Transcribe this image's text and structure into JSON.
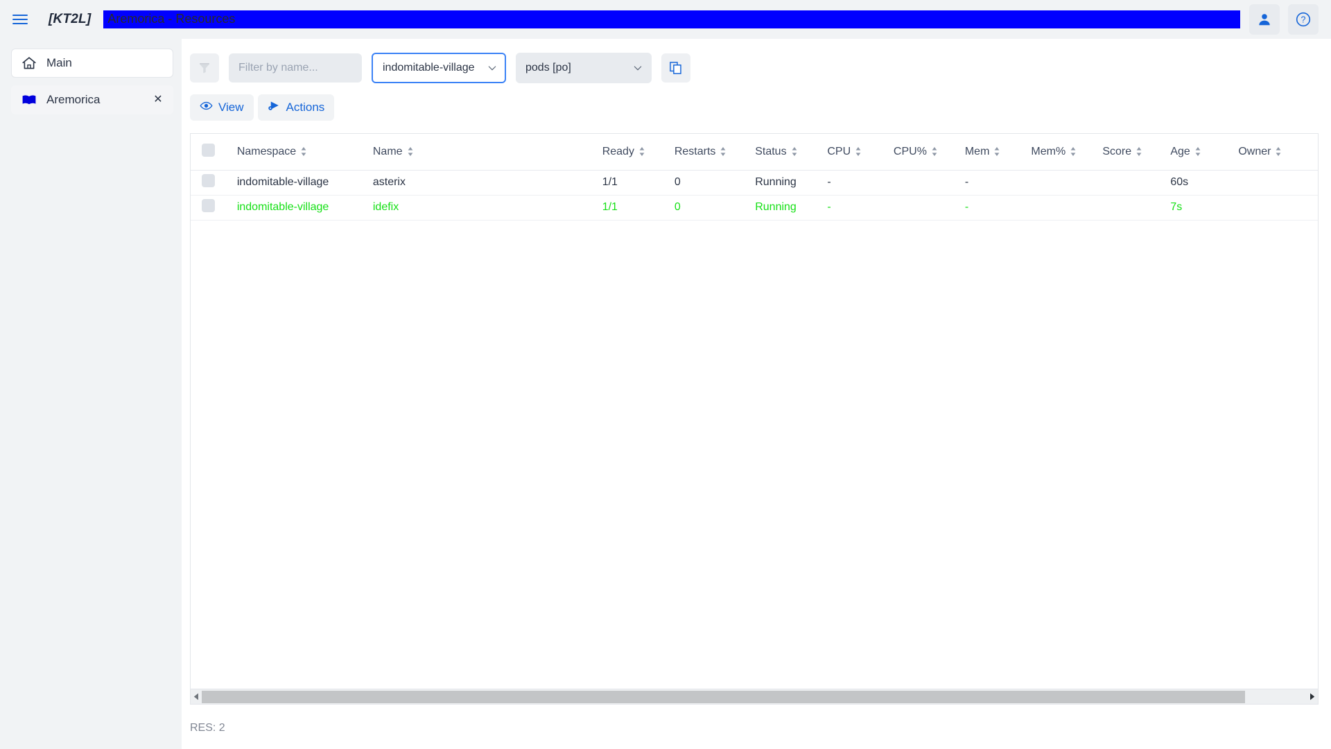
{
  "appbar": {
    "menu_icon": "hamburger-icon",
    "brand": "[KT2L]",
    "title": "Aremorica - Resources",
    "title_highlight_color": "#0000ff",
    "user_icon": "person-icon",
    "help_icon": "help-circle-icon"
  },
  "sidebar": {
    "items": [
      {
        "label": "Main",
        "icon": "home-icon",
        "active": false,
        "closable": false
      },
      {
        "label": "Aremorica",
        "icon": "book-icon",
        "active": true,
        "closable": true,
        "close_label": "✕"
      }
    ]
  },
  "toolbar": {
    "filter_icon": "funnel-icon",
    "filter_placeholder": "Filter by name...",
    "filter_value": "",
    "namespace_value": "indomitable-village",
    "kind_value": "pods [po]",
    "copy_icon": "copy-icon",
    "dropdown_icon": "chevron-down-icon"
  },
  "subbar": {
    "view_label": "View",
    "view_icon": "eye-icon",
    "actions_label": "Actions",
    "actions_icon": "actions-play-icon",
    "accent_color": "#1565d8"
  },
  "table": {
    "columns": [
      {
        "key": "check",
        "label": ""
      },
      {
        "key": "namespace",
        "label": "Namespace"
      },
      {
        "key": "name",
        "label": "Name"
      },
      {
        "key": "ready",
        "label": "Ready"
      },
      {
        "key": "restarts",
        "label": "Restarts"
      },
      {
        "key": "status",
        "label": "Status"
      },
      {
        "key": "cpu",
        "label": "CPU"
      },
      {
        "key": "cpup",
        "label": "CPU%"
      },
      {
        "key": "mem",
        "label": "Mem"
      },
      {
        "key": "memp",
        "label": "Mem%"
      },
      {
        "key": "score",
        "label": "Score"
      },
      {
        "key": "age",
        "label": "Age"
      },
      {
        "key": "owner",
        "label": "Owner"
      }
    ],
    "rows": [
      {
        "namespace": "indomitable-village",
        "name": "asterix",
        "ready": "1/1",
        "restarts": "0",
        "status": "Running",
        "cpu": "-",
        "cpup": "",
        "mem": "-",
        "memp": "",
        "score": "",
        "age": "60s",
        "owner": "",
        "highlight": false
      },
      {
        "namespace": "indomitable-village",
        "name": "idefix",
        "ready": "1/1",
        "restarts": "0",
        "status": "Running",
        "cpu": "-",
        "cpup": "",
        "mem": "-",
        "memp": "",
        "score": "",
        "age": "7s",
        "owner": "",
        "highlight": true
      }
    ],
    "highlight_color": "#16e016"
  },
  "statusbar": {
    "result_text": "RES: 2"
  }
}
